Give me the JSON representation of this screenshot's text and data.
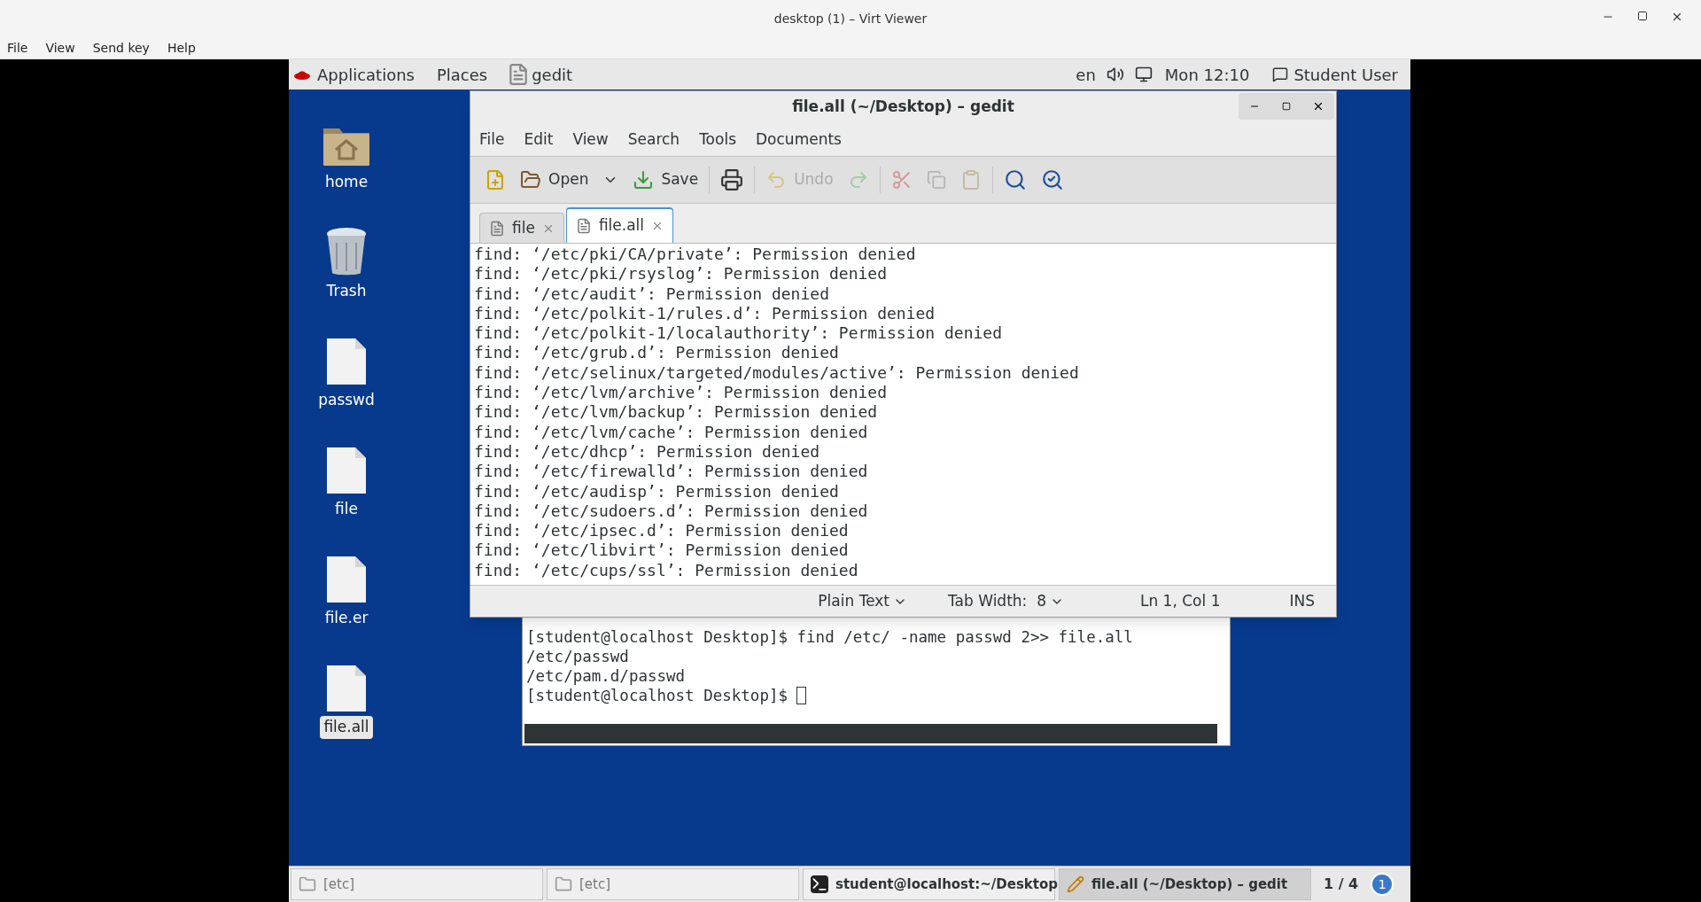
{
  "viewer": {
    "title": "desktop (1) – Virt Viewer",
    "menu": [
      "File",
      "View",
      "Send key",
      "Help"
    ]
  },
  "top_bar": {
    "applications": "Applications",
    "places": "Places",
    "app": "gedit",
    "language": "en",
    "clock": "Mon 12:10",
    "user": "Student User"
  },
  "desktop_icons": [
    {
      "label": "home",
      "kind": "folder",
      "selected": false
    },
    {
      "label": "Trash",
      "kind": "trash",
      "selected": false
    },
    {
      "label": "passwd",
      "kind": "file",
      "selected": false
    },
    {
      "label": "file",
      "kind": "file",
      "selected": false
    },
    {
      "label": "file.er",
      "kind": "file",
      "selected": false
    },
    {
      "label": "file.all",
      "kind": "file",
      "selected": true
    }
  ],
  "gedit": {
    "title": "file.all (~/Desktop) – gedit",
    "menu": [
      "File",
      "Edit",
      "View",
      "Search",
      "Tools",
      "Documents"
    ],
    "toolbar": [
      {
        "kind": "new",
        "disabled": false
      },
      {
        "kind": "open",
        "label": "Open",
        "disabled": false
      },
      {
        "kind": "save",
        "label": "Save",
        "disabled": false
      },
      {
        "kind": "print",
        "disabled": false
      },
      {
        "kind": "undo",
        "label": "Undo",
        "disabled": true
      },
      {
        "kind": "redo",
        "disabled": true
      },
      {
        "kind": "cut",
        "disabled": true
      },
      {
        "kind": "copy",
        "disabled": true
      },
      {
        "kind": "paste",
        "disabled": true
      },
      {
        "kind": "find",
        "disabled": false
      },
      {
        "kind": "replace",
        "disabled": false
      }
    ],
    "tabs": [
      {
        "label": "file",
        "selected": false
      },
      {
        "label": "file.all",
        "selected": true
      }
    ],
    "lines": [
      "find: ‘/etc/pki/CA/private’: Permission denied",
      "find: ‘/etc/pki/rsyslog’: Permission denied",
      "find: ‘/etc/audit’: Permission denied",
      "find: ‘/etc/polkit-1/rules.d’: Permission denied",
      "find: ‘/etc/polkit-1/localauthority’: Permission denied",
      "find: ‘/etc/grub.d’: Permission denied",
      "find: ‘/etc/selinux/targeted/modules/active’: Permission denied",
      "find: ‘/etc/lvm/archive’: Permission denied",
      "find: ‘/etc/lvm/backup’: Permission denied",
      "find: ‘/etc/lvm/cache’: Permission denied",
      "find: ‘/etc/dhcp’: Permission denied",
      "find: ‘/etc/firewalld’: Permission denied",
      "find: ‘/etc/audisp’: Permission denied",
      "find: ‘/etc/sudoers.d’: Permission denied",
      "find: ‘/etc/ipsec.d’: Permission denied",
      "find: ‘/etc/libvirt’: Permission denied",
      "find: ‘/etc/cups/ssl’: Permission denied"
    ],
    "status_bar": {
      "language": "Plain Text",
      "tab_width": "Tab Width:  8",
      "position": "Ln 1, Col 1",
      "mode": "INS"
    }
  },
  "terminal": {
    "lines": [
      "[student@localhost Desktop]$ find /etc/ -name passwd 2>> file.all",
      "/etc/passwd",
      "/etc/pam.d/passwd"
    ],
    "prompt": "[student@localhost Desktop]$"
  },
  "taskbar": {
    "items": [
      {
        "label": "[etc]",
        "kind": "folder",
        "selected": false
      },
      {
        "label": "[etc]",
        "kind": "folder",
        "selected": false
      },
      {
        "label": "student@localhost:~/Desktop",
        "kind": "terminal",
        "selected": false
      },
      {
        "label": "file.all (~/Desktop) – gedit",
        "kind": "editor",
        "selected": true
      }
    ],
    "workspace": "1 / 4",
    "notifications": "1"
  }
}
